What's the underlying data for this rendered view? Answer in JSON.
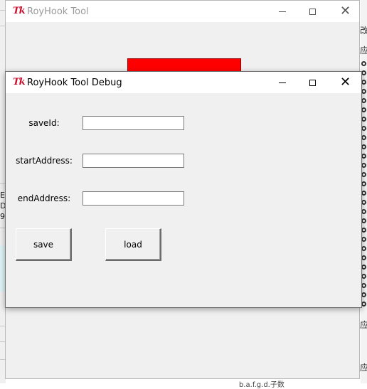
{
  "main_window": {
    "icon": "Tk",
    "title": "RoyHook Tool",
    "red_button_label": ""
  },
  "debug_window": {
    "icon": "Tk",
    "title": "RoyHook Tool Debug",
    "fields": [
      {
        "label": "saveId:",
        "value": ""
      },
      {
        "label": "startAddress:",
        "value": ""
      },
      {
        "label": "endAddress:",
        "value": ""
      }
    ],
    "save_label": "save",
    "load_label": "load"
  },
  "window_controls": {
    "minimize_icon": "minimize-icon",
    "maximize_icon": "maximize-icon",
    "close_glyph": "✕"
  },
  "background": {
    "left_text": [
      "E",
      "D",
      "9"
    ],
    "right_chars": [
      "改",
      "应",
      "应",
      "应"
    ],
    "bottom_text": "b.a.f.g.d.子数"
  }
}
